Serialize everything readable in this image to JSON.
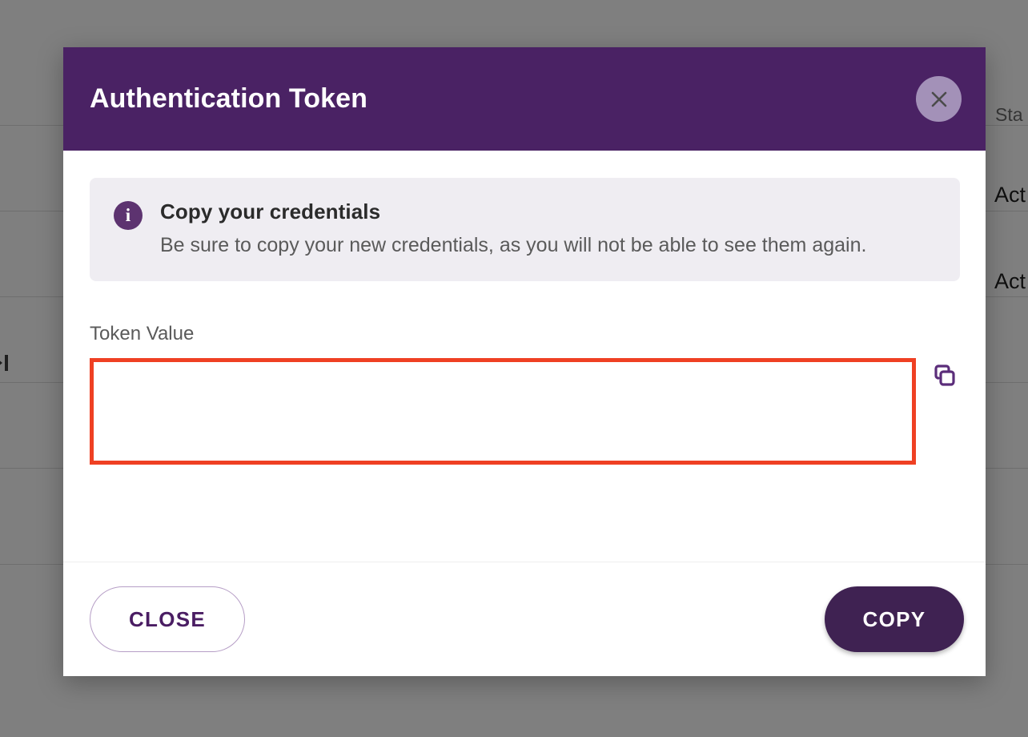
{
  "background": {
    "table": {
      "column_header": "Sta",
      "rows": [
        {
          "status": "Act"
        },
        {
          "status": "Act"
        }
      ]
    },
    "pagination": {
      "last_page_icon": "last-page-icon"
    }
  },
  "modal": {
    "title": "Authentication Token",
    "close_icon": "close-icon",
    "banner": {
      "icon": "info-icon",
      "icon_glyph": "i",
      "title": "Copy your credentials",
      "description": "Be sure to copy your new credentials, as you will not be able to see them again."
    },
    "field": {
      "label": "Token Value",
      "value": "",
      "placeholder": "",
      "copy_icon": "copy-icon"
    },
    "footer": {
      "close_label": "CLOSE",
      "copy_label": "COPY"
    }
  },
  "colors": {
    "header_purple": "#4A2264",
    "accent_purple": "#5D3370",
    "primary_button": "#3F2252",
    "banner_bg": "#EFEDF2",
    "annotation_outline": "#EF4023",
    "scrim": "rgba(0,0,0,0.5)"
  }
}
